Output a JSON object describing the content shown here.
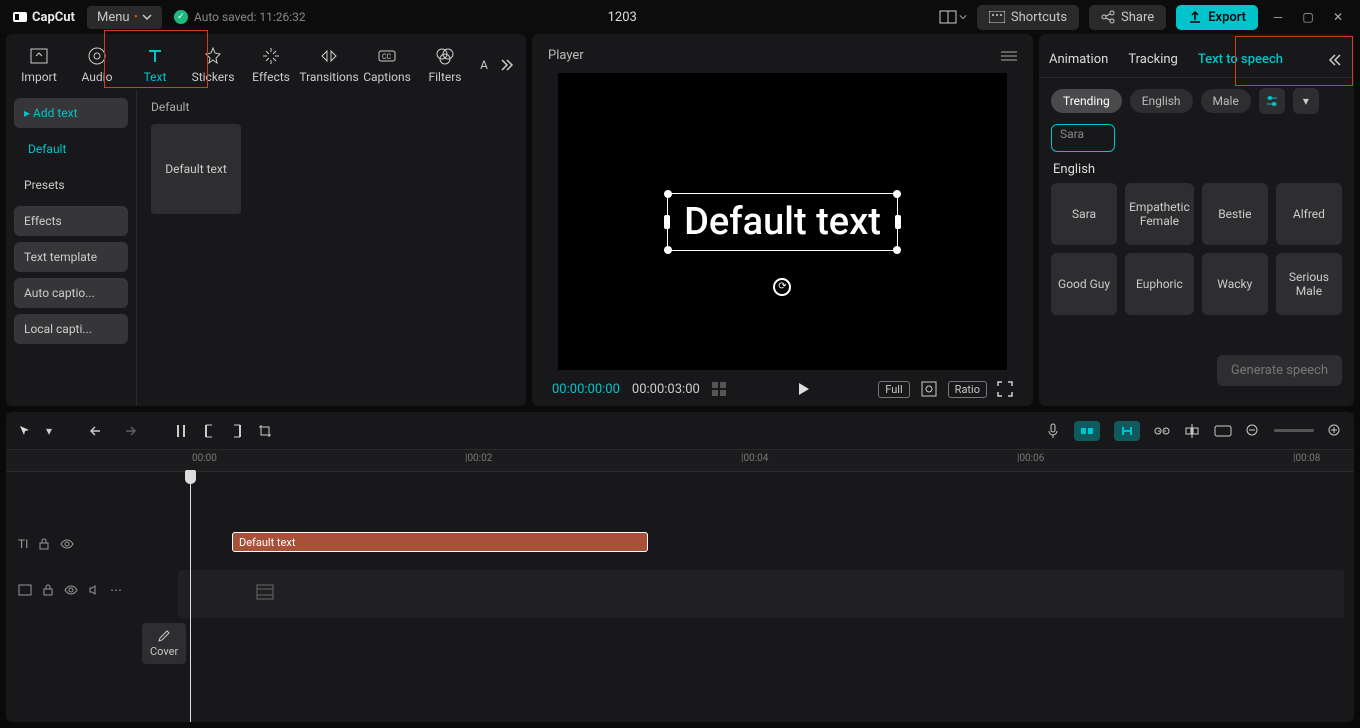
{
  "app": {
    "name": "CapCut",
    "menu": "Menu",
    "autosave": "Auto saved: 11:26:32",
    "project": "1203"
  },
  "header": {
    "shortcuts": "Shortcuts",
    "share": "Share",
    "export": "Export"
  },
  "mediaTabs": [
    "Import",
    "Audio",
    "Text",
    "Stickers",
    "Effects",
    "Transitions",
    "Captions",
    "Filters",
    "A"
  ],
  "sidebar": {
    "add_text": "Add text",
    "default": "Default",
    "presets": "Presets",
    "effects": "Effects",
    "template": "Text template",
    "auto": "Auto captio...",
    "local": "Local capti..."
  },
  "mediaContent": {
    "section": "Default",
    "thumb": "Default text"
  },
  "player": {
    "label": "Player",
    "text": "Default text",
    "cur": "00:00:00:00",
    "dur": "00:00:03:00",
    "full": "Full",
    "ratio": "Ratio"
  },
  "inspector": {
    "tabs": [
      "Animation",
      "Tracking",
      "Text to speech"
    ],
    "chips": [
      "Trending",
      "English",
      "Male"
    ],
    "selected_voice": "Sara",
    "lang": "English",
    "voices": [
      "Sara",
      "Empathetic Female",
      "Bestie",
      "Alfred",
      "Good Guy",
      "Euphoric",
      "Wacky",
      "Serious Male"
    ],
    "generate": "Generate speech"
  },
  "timeline": {
    "ruler": [
      "00:00",
      "|00:02",
      "|00:04",
      "|00:06",
      "|00:08"
    ],
    "clip": "Default text",
    "cover": "Cover"
  }
}
